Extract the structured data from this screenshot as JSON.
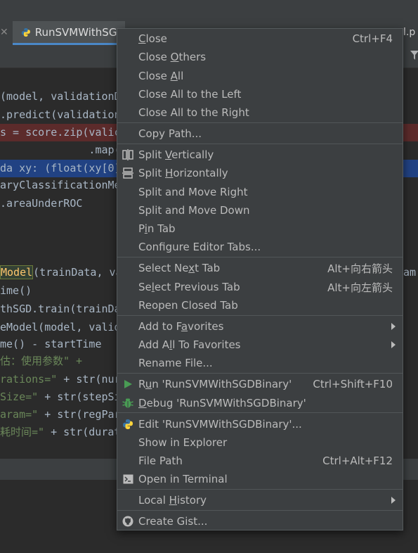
{
  "tab": {
    "active_label": "RunSVMWithSGD",
    "right_fragment": "l.p"
  },
  "code_lines": [
    {
      "text": "(model, validationD",
      "style": "normal"
    },
    {
      "text": ".predict(validation",
      "style": "normal"
    },
    {
      "text": "s = score.zip(valic",
      "style": "err"
    },
    {
      "text": "              .map(",
      "style": "normal"
    },
    {
      "text": "da xy: (float(xy[0]",
      "style": "sel"
    },
    {
      "text": "aryClassificationMe",
      "style": "normal"
    },
    {
      "text": ".areaUnderROC",
      "style": "normal"
    },
    {
      "text": "",
      "style": "normal"
    },
    {
      "text": "",
      "style": "normal"
    },
    {
      "text": "Model(trainData, va",
      "style": "fn",
      "right": "am"
    },
    {
      "text": "ime()",
      "style": "normal"
    },
    {
      "text": "thSGD.train(trainDa",
      "style": "normal"
    },
    {
      "text": "eModel(model, valid",
      "style": "normal"
    },
    {
      "text": "me() - startTime",
      "style": "normal"
    },
    {
      "text": "估：使用参数\" +",
      "style": "str"
    },
    {
      "text": "rations=\" + str(nur",
      "style": "mixed"
    },
    {
      "text": "Size=\" + str(stepSi",
      "style": "mixed"
    },
    {
      "text": "aram=\" + str(regPar",
      "style": "mixed"
    },
    {
      "text": "耗时间=\" + str(durati",
      "style": "mixed"
    }
  ],
  "menu": {
    "items": [
      {
        "id": "close",
        "label": "Close",
        "ul": "C",
        "shortcut": "Ctrl+F4",
        "icon": ""
      },
      {
        "id": "close-others",
        "label": "Close Others",
        "ul": "O",
        "shortcut": "",
        "icon": ""
      },
      {
        "id": "close-all",
        "label": "Close All",
        "ul": "A",
        "shortcut": "",
        "icon": ""
      },
      {
        "id": "close-all-left",
        "label": "Close All to the Left",
        "ul": "",
        "shortcut": "",
        "icon": ""
      },
      {
        "id": "close-all-right",
        "label": "Close All to the Right",
        "ul": "",
        "shortcut": "",
        "icon": ""
      },
      {
        "id": "sep1",
        "separator": true
      },
      {
        "id": "copy-path",
        "label": "Copy Path...",
        "ul": "",
        "shortcut": "",
        "icon": ""
      },
      {
        "id": "sep2",
        "separator": true
      },
      {
        "id": "split-vertically",
        "label": "Split Vertically",
        "ul": "V",
        "shortcut": "",
        "icon": "split-vertical"
      },
      {
        "id": "split-horizontally",
        "label": "Split Horizontally",
        "ul": "H",
        "shortcut": "",
        "icon": "split-horizontal"
      },
      {
        "id": "split-move-right",
        "label": "Split and Move Right",
        "ul": "",
        "shortcut": "",
        "icon": ""
      },
      {
        "id": "split-move-down",
        "label": "Split and Move Down",
        "ul": "",
        "shortcut": "",
        "icon": ""
      },
      {
        "id": "pin-tab",
        "label": "Pin Tab",
        "ul": "i",
        "shortcut": "",
        "icon": ""
      },
      {
        "id": "configure-tabs",
        "label": "Configure Editor Tabs...",
        "ul": "",
        "shortcut": "",
        "icon": ""
      },
      {
        "id": "sep3",
        "separator": true
      },
      {
        "id": "select-next-tab",
        "label": "Select Next Tab",
        "ul": "x",
        "shortcut": "Alt+向右箭头",
        "icon": ""
      },
      {
        "id": "select-prev-tab",
        "label": "Select Previous Tab",
        "ul": "l",
        "shortcut": "Alt+向左箭头",
        "icon": ""
      },
      {
        "id": "reopen-closed-tab",
        "label": "Reopen Closed Tab",
        "ul": "",
        "shortcut": "",
        "icon": ""
      },
      {
        "id": "sep4",
        "separator": true
      },
      {
        "id": "add-to-favorites",
        "label": "Add to Favorites",
        "ul": "a",
        "shortcut": "",
        "icon": "",
        "submenu": true
      },
      {
        "id": "add-all-favorites",
        "label": "Add All To Favorites",
        "ul": "l",
        "shortcut": "",
        "icon": "",
        "submenu": true
      },
      {
        "id": "rename-file",
        "label": "Rename File...",
        "ul": "",
        "shortcut": "",
        "icon": ""
      },
      {
        "id": "sep5",
        "separator": true
      },
      {
        "id": "run",
        "label": "Run 'RunSVMWithSGDBinary'",
        "ul": "u",
        "shortcut": "Ctrl+Shift+F10",
        "icon": "run"
      },
      {
        "id": "debug",
        "label": "Debug 'RunSVMWithSGDBinary'",
        "ul": "D",
        "shortcut": "",
        "icon": "debug"
      },
      {
        "id": "sep6",
        "separator": true
      },
      {
        "id": "edit-config",
        "label": "Edit 'RunSVMWithSGDBinary'...",
        "ul": "",
        "shortcut": "",
        "icon": "python"
      },
      {
        "id": "show-explorer",
        "label": "Show in Explorer",
        "ul": "",
        "shortcut": "",
        "icon": ""
      },
      {
        "id": "file-path",
        "label": "File Path",
        "ul": "",
        "shortcut": "Ctrl+Alt+F12",
        "icon": ""
      },
      {
        "id": "open-terminal",
        "label": "Open in Terminal",
        "ul": "",
        "shortcut": "",
        "icon": "terminal"
      },
      {
        "id": "sep7",
        "separator": true
      },
      {
        "id": "local-history",
        "label": "Local History",
        "ul": "H",
        "shortcut": "",
        "icon": "",
        "submenu": true
      },
      {
        "id": "sep8",
        "separator": true
      },
      {
        "id": "create-gist",
        "label": "Create Gist...",
        "ul": "",
        "shortcut": "",
        "icon": "github"
      }
    ]
  },
  "colors": {
    "menu_bg": "#3c3f41",
    "menu_text": "#bbbbbb",
    "run_green": "#499c54",
    "debug_green": "#499c54",
    "python_blue": "#3572a5",
    "python_yellow": "#ffd43b"
  }
}
